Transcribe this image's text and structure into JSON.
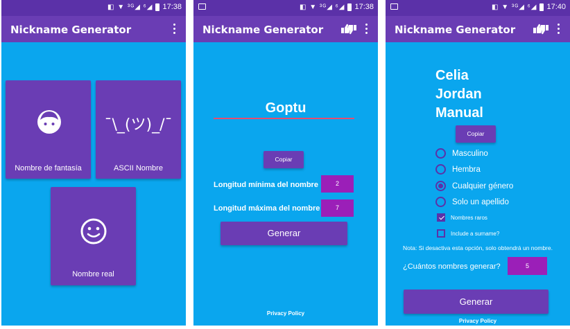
{
  "status": {
    "time1": "17:38",
    "time2": "17:38",
    "time3": "17:40",
    "icons": "◧ ▼ ³ᴳ◢ ⁶◢"
  },
  "app": {
    "title": "Nickname Generator"
  },
  "screen1": {
    "tile_fantasy": "Nombre de fantasía",
    "tile_ascii": "ASCII Nombre",
    "ascii_art": "¯\\_(ツ)_/¯",
    "tile_real": "Nombre real"
  },
  "screen2": {
    "name": "Goptu",
    "copy_label": "Copiar",
    "min_label": "Longitud mínima del nombre",
    "min_value": "2",
    "max_label": "Longitud máxima del nombre",
    "max_value": "7",
    "generate_label": "Generar",
    "privacy": "Privacy Policy"
  },
  "screen3": {
    "name_line1": "Celia",
    "name_line2": "Jordan",
    "name_line3": "Manual",
    "copy_label": "Copiar",
    "options": [
      "Masculino",
      "Hembra",
      "Cualquier género",
      "Solo un apellido"
    ],
    "selected_option": "Cualquier género",
    "check_rare": "Nombres raros",
    "check_surname": "Include a surname?",
    "note": "Nota: Si desactiva esta opción, solo obtendrá un nombre.",
    "count_label": "¿Cuántos nombres generar?",
    "count_value": "5",
    "generate_label": "Generar",
    "privacy": "Privacy Policy"
  },
  "colors": {
    "background": "#0aa6ee",
    "primary": "#6a3db4",
    "accent_box": "#9b1fb8",
    "status": "#5b31a8"
  }
}
